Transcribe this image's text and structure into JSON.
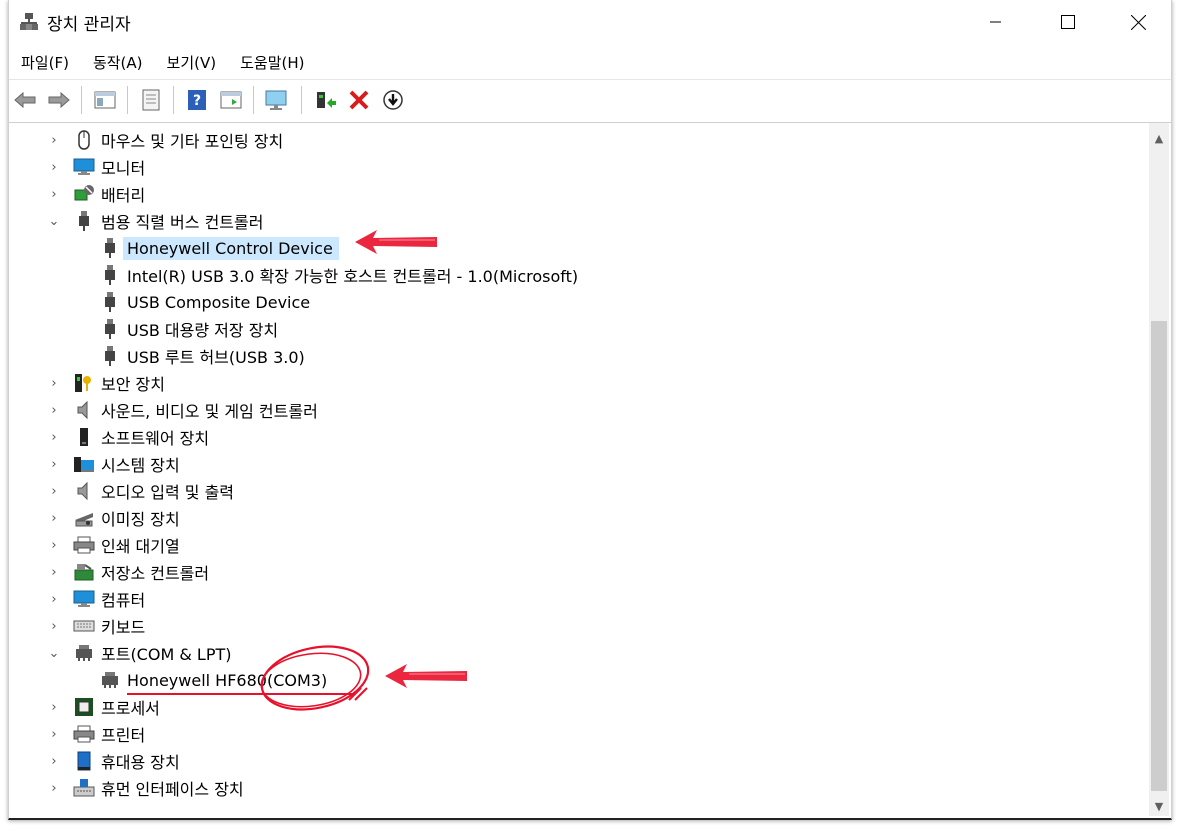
{
  "window": {
    "title": "장치 관리자"
  },
  "menu": [
    "파일(F)",
    "동작(A)",
    "보기(V)",
    "도움말(H)"
  ],
  "tree": {
    "items": [
      {
        "label": "마우스 및 기타 포인팅 장치",
        "icon": "mouse-icon",
        "state": "collapsed"
      },
      {
        "label": "모니터",
        "icon": "monitor-icon",
        "state": "collapsed"
      },
      {
        "label": "배터리",
        "icon": "battery-icon",
        "state": "collapsed"
      },
      {
        "label": "범용 직렬 버스 컨트롤러",
        "icon": "usb-icon",
        "state": "expanded"
      },
      {
        "label": "Honeywell Control Device",
        "icon": "usb-icon",
        "child": true,
        "selected": true
      },
      {
        "label": "Intel(R) USB 3.0 확장 가능한 호스트 컨트롤러 - 1.0(Microsoft)",
        "icon": "usb-icon",
        "child": true
      },
      {
        "label": "USB Composite Device",
        "icon": "usb-icon",
        "child": true
      },
      {
        "label": "USB 대용량 저장 장치",
        "icon": "usb-icon",
        "child": true
      },
      {
        "label": "USB 루트 허브(USB 3.0)",
        "icon": "usb-icon",
        "child": true
      },
      {
        "label": "보안 장치",
        "icon": "security-key-icon",
        "state": "collapsed"
      },
      {
        "label": "사운드, 비디오 및 게임 컨트롤러",
        "icon": "speaker-icon",
        "state": "collapsed"
      },
      {
        "label": "소프트웨어 장치",
        "icon": "software-device-icon",
        "state": "collapsed"
      },
      {
        "label": "시스템 장치",
        "icon": "system-folder-icon",
        "state": "collapsed"
      },
      {
        "label": "오디오 입력 및 출력",
        "icon": "speaker-icon",
        "state": "collapsed"
      },
      {
        "label": "이미징 장치",
        "icon": "camera-icon",
        "state": "collapsed"
      },
      {
        "label": "인쇄 대기열",
        "icon": "printer-icon",
        "state": "collapsed"
      },
      {
        "label": "저장소 컨트롤러",
        "icon": "storage-controller-icon",
        "state": "collapsed"
      },
      {
        "label": "컴퓨터",
        "icon": "computer-icon",
        "state": "collapsed"
      },
      {
        "label": "키보드",
        "icon": "keyboard-icon",
        "state": "collapsed"
      },
      {
        "label": "포트(COM & LPT)",
        "icon": "port-icon",
        "state": "expanded"
      },
      {
        "label": "Honeywell HF680(COM3)",
        "icon": "port-icon",
        "child": true
      },
      {
        "label": "프로세서",
        "icon": "processor-icon",
        "state": "collapsed"
      },
      {
        "label": "프린터",
        "icon": "printer-icon",
        "state": "collapsed"
      },
      {
        "label": "휴대용 장치",
        "icon": "portable-device-icon",
        "state": "collapsed"
      },
      {
        "label": "휴먼 인터페이스 장치",
        "icon": "hid-icon",
        "state": "collapsed"
      }
    ]
  },
  "colors": {
    "selection": "#cce8ff",
    "annotation_red": "#e8102a",
    "delete_red": "#d81b1b"
  }
}
